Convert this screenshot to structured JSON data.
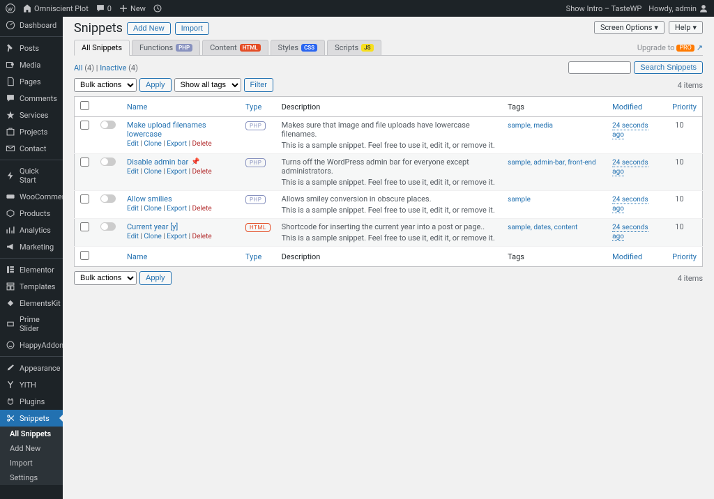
{
  "topbar": {
    "site": "Omniscient Plot",
    "comments": "0",
    "new": "New",
    "show_intro": "Show Intro – TasteWP",
    "howdy": "Howdy, admin",
    "screen_options": "Screen Options",
    "help": "Help"
  },
  "sidebar": {
    "items": [
      {
        "label": "Dashboard",
        "icon": "dashboard"
      },
      {
        "label": "Posts",
        "icon": "posts"
      },
      {
        "label": "Media",
        "icon": "media"
      },
      {
        "label": "Pages",
        "icon": "pages"
      },
      {
        "label": "Comments",
        "icon": "comments"
      },
      {
        "label": "Services",
        "icon": "services"
      },
      {
        "label": "Projects",
        "icon": "projects"
      },
      {
        "label": "Contact",
        "icon": "contact"
      },
      {
        "label": "Quick Start",
        "icon": "bolt"
      },
      {
        "label": "WooCommerce",
        "icon": "woo"
      },
      {
        "label": "Products",
        "icon": "products"
      },
      {
        "label": "Analytics",
        "icon": "analytics"
      },
      {
        "label": "Marketing",
        "icon": "marketing"
      },
      {
        "label": "Elementor",
        "icon": "elementor"
      },
      {
        "label": "Templates",
        "icon": "templates"
      },
      {
        "label": "ElementsKit",
        "icon": "ekit"
      },
      {
        "label": "Prime Slider",
        "icon": "slider"
      },
      {
        "label": "HappyAddons",
        "icon": "happy"
      },
      {
        "label": "Appearance",
        "icon": "appearance"
      },
      {
        "label": "YITH",
        "icon": "yith"
      },
      {
        "label": "Plugins",
        "icon": "plugins"
      },
      {
        "label": "Snippets",
        "icon": "snippets"
      }
    ],
    "submenu": {
      "all": "All Snippets",
      "add": "Add New",
      "import": "Import",
      "settings": "Settings"
    }
  },
  "page": {
    "title": "Snippets",
    "add_new": "Add New",
    "import": "Import"
  },
  "tabs": [
    {
      "label": "All Snippets",
      "badge": ""
    },
    {
      "label": "Functions",
      "badge": "PHP",
      "badge_class": "php"
    },
    {
      "label": "Content",
      "badge": "HTML",
      "badge_class": "html"
    },
    {
      "label": "Styles",
      "badge": "CSS",
      "badge_class": "css"
    },
    {
      "label": "Scripts",
      "badge": "JS",
      "badge_class": "js"
    }
  ],
  "upgrade": {
    "text": "Upgrade to",
    "pro": "PRO"
  },
  "views": {
    "all": "All",
    "all_count": "(4)",
    "inactive": "Inactive",
    "inactive_count": "(4)"
  },
  "search_btn": "Search Snippets",
  "bulk": {
    "label": "Bulk actions",
    "apply": "Apply",
    "show_all_tags": "Show all tags",
    "filter": "Filter"
  },
  "items_count": "4 items",
  "columns": {
    "name": "Name",
    "type": "Type",
    "description": "Description",
    "tags": "Tags",
    "modified": "Modified",
    "priority": "Priority"
  },
  "row_actions": {
    "edit": "Edit",
    "clone": "Clone",
    "export": "Export",
    "delete": "Delete"
  },
  "snippets": [
    {
      "name": "Make upload filenames lowercase",
      "type": "PHP",
      "type_class": "php",
      "desc1": "Makes sure that image and file uploads have lowercase filenames.",
      "desc2": "This is a sample snippet. Feel free to use it, edit it, or remove it.",
      "tags": "sample, media",
      "modified": "24 seconds ago",
      "priority": "10"
    },
    {
      "name": "Disable admin bar",
      "pinned": true,
      "type": "PHP",
      "type_class": "php",
      "desc1": "Turns off the WordPress admin bar for everyone except administrators.",
      "desc2": "This is a sample snippet. Feel free to use it, edit it, or remove it.",
      "tags": "sample, admin-bar, front-end",
      "modified": "24 seconds ago",
      "priority": "10"
    },
    {
      "name": "Allow smilies",
      "type": "PHP",
      "type_class": "php",
      "desc1": "Allows smiley conversion in obscure places.",
      "desc2": "This is a sample snippet. Feel free to use it, edit it, or remove it.",
      "tags": "sample",
      "modified": "24 seconds ago",
      "priority": "10"
    },
    {
      "name": "Current year [y]",
      "type": "HTML",
      "type_class": "html",
      "desc1": "Shortcode for inserting the current year into a post or page..",
      "desc2": "This is a sample snippet. Feel free to use it, edit it, or remove it.",
      "tags": "sample, dates, content",
      "modified": "24 seconds ago",
      "priority": "10"
    }
  ]
}
